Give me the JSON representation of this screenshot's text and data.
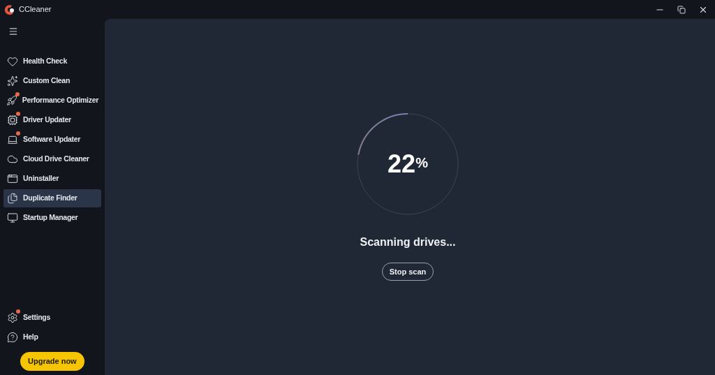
{
  "window": {
    "title": "CCleaner"
  },
  "sidebar": {
    "items": [
      {
        "label": "Health Check",
        "badge": false,
        "selected": false
      },
      {
        "label": "Custom Clean",
        "badge": false,
        "selected": false
      },
      {
        "label": "Performance Optimizer",
        "badge": true,
        "selected": false
      },
      {
        "label": "Driver Updater",
        "badge": true,
        "selected": false
      },
      {
        "label": "Software Updater",
        "badge": true,
        "selected": false
      },
      {
        "label": "Cloud Drive Cleaner",
        "badge": false,
        "selected": false
      },
      {
        "label": "Uninstaller",
        "badge": false,
        "selected": false
      },
      {
        "label": "Duplicate Finder",
        "badge": false,
        "selected": true
      },
      {
        "label": "Startup Manager",
        "badge": false,
        "selected": false
      }
    ],
    "bottom_items": [
      {
        "label": "Settings",
        "badge": true
      },
      {
        "label": "Help",
        "badge": false
      }
    ],
    "upgrade_button": "Upgrade now"
  },
  "scan": {
    "percent": "22",
    "percent_sign": "%",
    "level": 0.22,
    "status": "Scanning drives...",
    "stop_button": "Stop scan"
  }
}
